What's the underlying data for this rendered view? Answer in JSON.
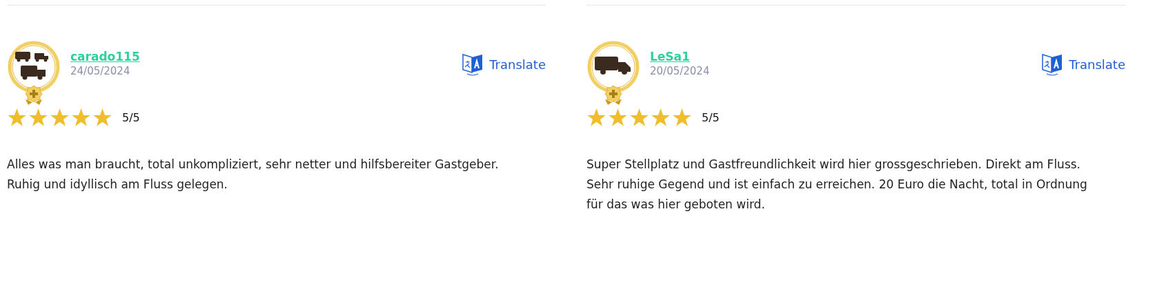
{
  "reviews": [
    {
      "kind": "fleet",
      "username": "carado115",
      "date": "24/05/2024",
      "translate": "Translate",
      "stars": 5,
      "score": "5/5",
      "text": "Alles was man braucht, total unkompliziert, sehr netter und hilfsbereiter Gastgeber. Ruhig und idyllisch am Fluss gelegen."
    },
    {
      "kind": "single",
      "username": "LeSa1",
      "date": "20/05/2024",
      "translate": "Translate",
      "stars": 5,
      "score": "5/5",
      "text": "Super Stellplatz und Gastfreundlichkeit wird hier grossgeschrieben. Direkt am Fluss. Sehr ruhige Gegend und ist einfach zu erreichen. 20 Euro die Nacht, total in Ordnung für das was hier geboten wird."
    }
  ]
}
